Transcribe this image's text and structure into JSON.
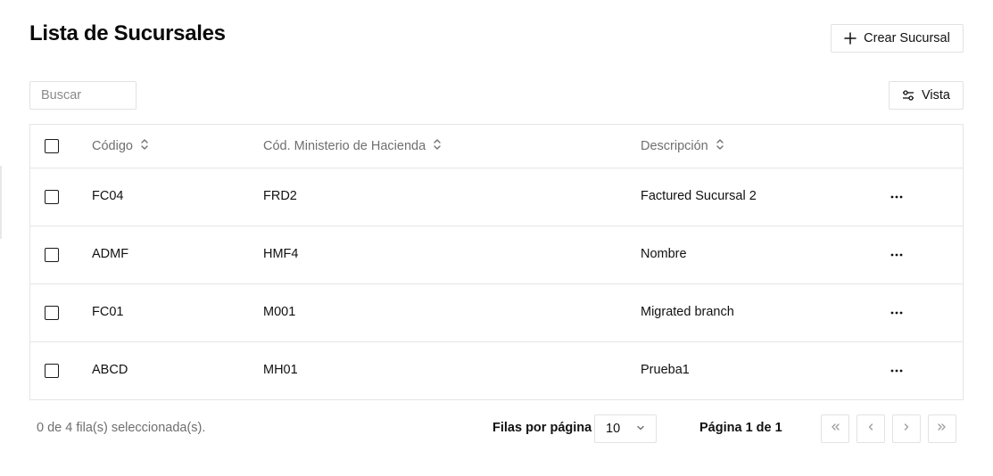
{
  "header": {
    "title": "Lista de Sucursales",
    "create_label": "Crear Sucursal"
  },
  "toolbar": {
    "search_placeholder": "Buscar",
    "view_label": "Vista"
  },
  "table": {
    "columns": [
      "Código",
      "Cód. Ministerio de Hacienda",
      "Descripción"
    ],
    "rows": [
      [
        "FC04",
        "FRD2",
        "Factured Sucursal 2"
      ],
      [
        "ADMF",
        "HMF4",
        "Nombre"
      ],
      [
        "FC01",
        "M001",
        "Migrated branch"
      ],
      [
        "ABCD",
        "MH01",
        "Prueba1"
      ]
    ]
  },
  "footer": {
    "selection_text": "0 de 4 fila(s) seleccionada(s).",
    "rows_per_page_label": "Filas por página",
    "rows_per_page_value": "10",
    "page_text": "Página 1 de 1"
  },
  "icons": {
    "create": "plus-icon",
    "view": "sliders-icon",
    "sort": "sort-icon",
    "row_actions": "more-horizontal-icon",
    "select": "chevron-down-icon",
    "first": "chevrons-left-icon",
    "prev": "chevron-left-icon",
    "next": "chevron-right-icon",
    "last": "chevrons-right-icon"
  },
  "colors": {
    "border": "#e5e5e5",
    "text": "#111111",
    "muted": "#6f6f6f",
    "pager_icon": "#9a9a9a"
  }
}
